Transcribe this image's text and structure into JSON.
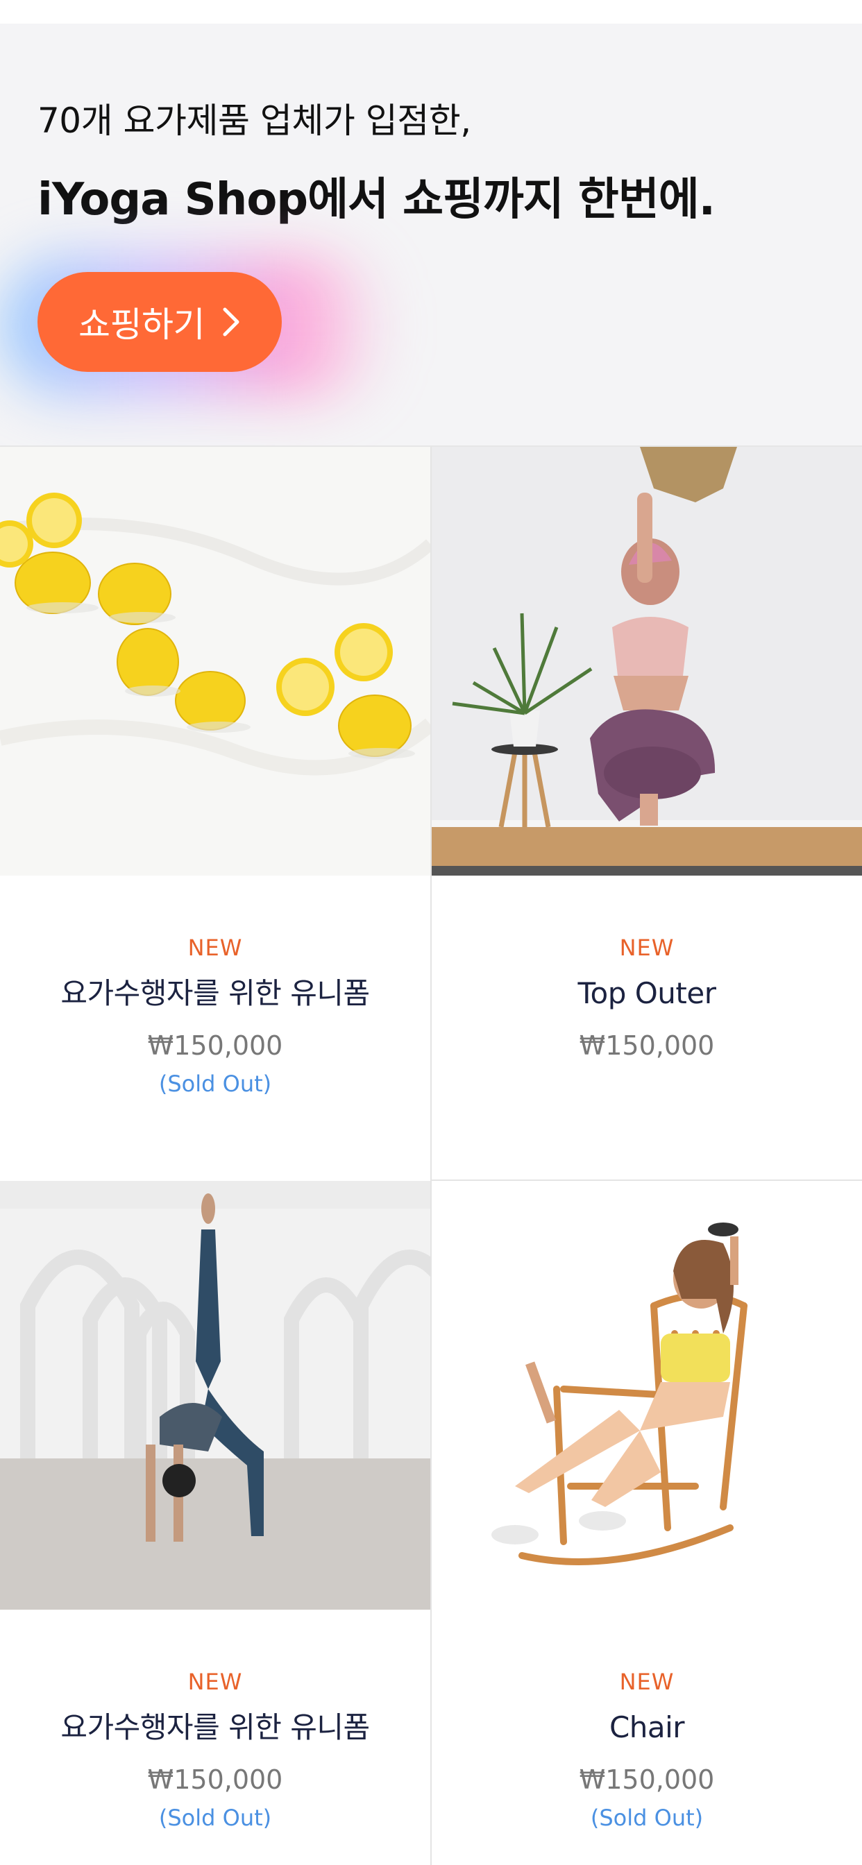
{
  "hero": {
    "line1": "70개 요가제품 업체가 입점한,",
    "line2": "iYoga Shop에서 쇼핑까지 한번에.",
    "cta_label": "쇼핑하기",
    "cta_icon": "chevron-right-icon",
    "cta_color": "#ff6936"
  },
  "products": [
    {
      "badge": "NEW",
      "name": "요가수행자를 위한 유니폼",
      "price": "₩150,000",
      "status": "(Sold Out)",
      "image": "lemons-photo"
    },
    {
      "badge": "NEW",
      "name": "Top Outer",
      "price": "₩150,000",
      "status": "",
      "image": "yoga-eagle-pose-photo"
    },
    {
      "badge": "NEW",
      "name": "요가수행자를 위한 유니폼",
      "price": "₩150,000",
      "status": "(Sold Out)",
      "image": "yoga-wheel-pose-photo"
    },
    {
      "badge": "NEW",
      "name": "Chair",
      "price": "₩150,000",
      "status": "(Sold Out)",
      "image": "woman-rocking-chair-photo"
    }
  ],
  "colors": {
    "badge": "#e8622a",
    "name": "#1b2240",
    "price": "#777777",
    "sold_out": "#4a90e2",
    "hero_bg": "#f4f4f6"
  }
}
